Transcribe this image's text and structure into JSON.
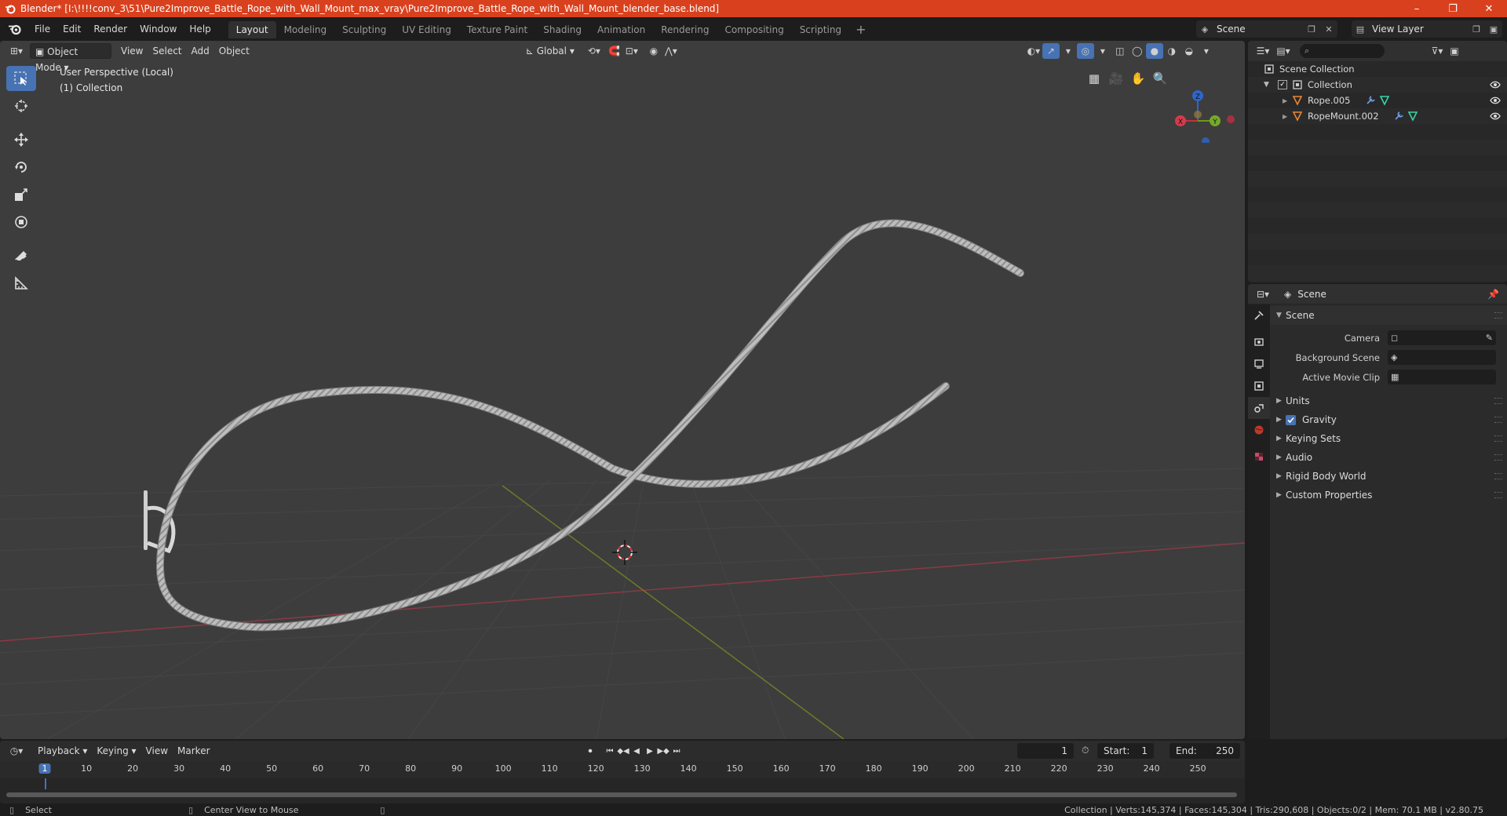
{
  "window": {
    "title": "Blender* [I:\\!!!!conv_3\\51\\Pure2Improve_Battle_Rope_with_Wall_Mount_max_vray\\Pure2Improve_Battle_Rope_with_Wall_Mount_blender_base.blend]",
    "minimize": "–",
    "maximize": "❐",
    "close": "✕"
  },
  "menu": [
    "File",
    "Edit",
    "Render",
    "Window",
    "Help"
  ],
  "workspaces": [
    "Layout",
    "Modeling",
    "Sculpting",
    "UV Editing",
    "Texture Paint",
    "Shading",
    "Animation",
    "Rendering",
    "Compositing",
    "Scripting"
  ],
  "workspace_add": "+",
  "scene_selector": "Scene",
  "view_layer_selector": "View Layer",
  "viewport": {
    "mode": "Object Mode",
    "menus": [
      "View",
      "Select",
      "Add",
      "Object"
    ],
    "transform_orientation": "Global",
    "info_line1": "User Perspective (Local)",
    "info_line2": "(1) Collection",
    "gizmo": {
      "x": "X",
      "y": "Y",
      "z": "Z"
    }
  },
  "outliner": {
    "rows": [
      {
        "label": "Scene Collection",
        "indent": 0
      },
      {
        "label": "Collection",
        "indent": 1
      },
      {
        "label": "Rope.005",
        "indent": 2
      },
      {
        "label": "RopeMount.002",
        "indent": 2
      }
    ]
  },
  "properties": {
    "header_title": "Scene",
    "scene_panel": "Scene",
    "fields": [
      {
        "label": "Camera",
        "value": ""
      },
      {
        "label": "Background Scene",
        "value": ""
      },
      {
        "label": "Active Movie Clip",
        "value": ""
      }
    ],
    "panels": [
      "Units",
      "Gravity",
      "Keying Sets",
      "Audio",
      "Rigid Body World",
      "Custom Properties"
    ]
  },
  "timeline": {
    "menus": [
      "Playback",
      "Keying",
      "View",
      "Marker"
    ],
    "current_frame": "1",
    "start_label": "Start:",
    "start": "1",
    "end_label": "End:",
    "end": "250",
    "ruler": [
      "1",
      "10",
      "20",
      "30",
      "40",
      "50",
      "60",
      "70",
      "80",
      "90",
      "100",
      "110",
      "120",
      "130",
      "140",
      "150",
      "160",
      "170",
      "180",
      "190",
      "200",
      "210",
      "220",
      "230",
      "240",
      "250"
    ]
  },
  "statusbar": {
    "left_action": "Select",
    "middle_action": "Center View to Mouse",
    "stats": "Collection | Verts:145,374 | Faces:145,304 | Tris:290,608 | Objects:0/2 | Mem: 70.1 MB | v2.80.75"
  }
}
